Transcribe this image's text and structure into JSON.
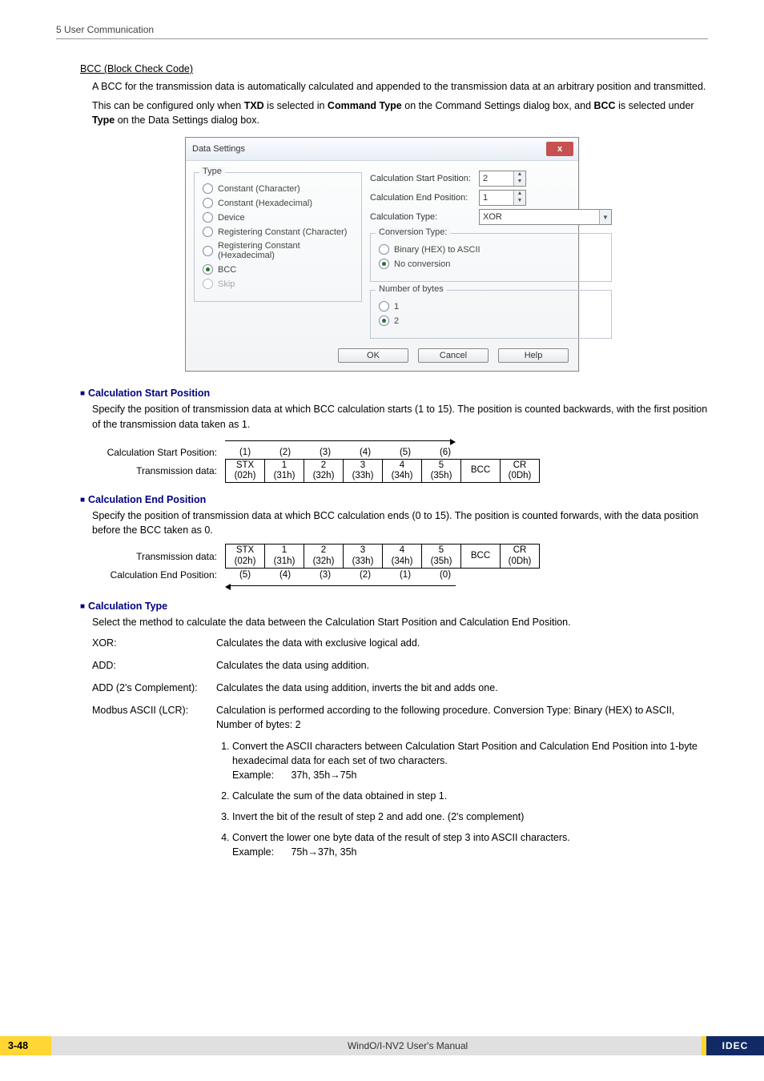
{
  "header": {
    "section": "5 User Communication"
  },
  "bcc": {
    "title": "BCC (Block Check Code)",
    "para1": "A BCC for the transmission data is automatically calculated and appended to the transmission data at an arbitrary position and transmitted.",
    "para2a": "This can be configured only when ",
    "para2_txd": "TXD",
    "para2b": " is selected in ",
    "para2_ct": "Command Type",
    "para2c": " on the Command Settings dialog box, and ",
    "para2_bcc": "BCC",
    "para2d": " is selected under ",
    "para2_type": "Type",
    "para2e": " on the Data Settings dialog box."
  },
  "dlg": {
    "title": "Data Settings",
    "close": "x",
    "type_legend": "Type",
    "t_constchar": "Constant (Character)",
    "t_consthex": "Constant (Hexadecimal)",
    "t_device": "Device",
    "t_regchar": "Registering Constant (Character)",
    "t_reghex": "Registering Constant (Hexadecimal)",
    "t_bcc": "BCC",
    "t_skip": "Skip",
    "calc_start_lbl": "Calculation Start Position:",
    "calc_start_val": "2",
    "calc_end_lbl": "Calculation End Position:",
    "calc_end_val": "1",
    "calc_type_lbl": "Calculation Type:",
    "calc_type_val": "XOR",
    "conv_legend": "Conversion Type:",
    "conv_bin": "Binary (HEX) to ASCII",
    "conv_none": "No conversion",
    "nbytes_legend": "Number of bytes",
    "nbytes_1": "1",
    "nbytes_2": "2",
    "btn_ok": "OK",
    "btn_cancel": "Cancel",
    "btn_help": "Help"
  },
  "calc_start": {
    "hdr": "Calculation Start Position",
    "para": "Specify the position of transmission data at which BCC calculation starts (1 to 15). The position is counted backwards, with the first position of the transmission data taken as 1.",
    "row_label": "Calculation Start Position:",
    "data_label": "Transmission data:",
    "seq": [
      "(1)",
      "(2)",
      "(3)",
      "(4)",
      "(5)",
      "(6)"
    ],
    "cells_top": [
      "STX",
      "1",
      "2",
      "3",
      "4",
      "5",
      "BCC",
      "CR"
    ],
    "cells_bot": [
      "(02h)",
      "(31h)",
      "(32h)",
      "(33h)",
      "(34h)",
      "(35h)",
      "",
      "(0Dh)"
    ]
  },
  "calc_end": {
    "hdr": "Calculation End Position",
    "para": "Specify the position of transmission data at which BCC calculation ends (0 to 15). The position is counted forwards, with the data position before the BCC taken as 0.",
    "row_label": "Calculation End Position:",
    "data_label": "Transmission data:",
    "seq": [
      "(5)",
      "(4)",
      "(3)",
      "(2)",
      "(1)",
      "(0)"
    ],
    "cells_top": [
      "STX",
      "1",
      "2",
      "3",
      "4",
      "5",
      "BCC",
      "CR"
    ],
    "cells_bot": [
      "(02h)",
      "(31h)",
      "(32h)",
      "(33h)",
      "(34h)",
      "(35h)",
      "",
      "(0Dh)"
    ]
  },
  "calc_type": {
    "hdr": "Calculation Type",
    "para": "Select the method to calculate the data between the Calculation Start Position and Calculation End Position.",
    "xor_k": "XOR:",
    "xor_v": "Calculates the data with exclusive logical add.",
    "add_k": "ADD:",
    "add_v": "Calculates the data using addition.",
    "add2c_k": "ADD (2's Complement):",
    "add2c_v": "Calculates the data using addition, inverts the bit and adds one.",
    "modbus_k": "Modbus ASCII (LCR):",
    "modbus_v": "Calculation is performed according to the following procedure. Conversion Type: Binary (HEX) to ASCII, Number of bytes: 2",
    "step1": "Convert the ASCII characters between Calculation Start Position and Calculation End Position into 1-byte hexadecimal data for each set of two characters.",
    "step1_example_lbl": "Example:",
    "step1_example_v": "37h, 35h→75h",
    "step2": "Calculate the sum of the data obtained in step 1.",
    "step3": "Invert the bit of the result of step 2 and add one. (2's complement)",
    "step4": "Convert the lower one byte data of the result of step 3 into ASCII characters.",
    "step4_example_lbl": "Example:",
    "step4_example_v": "75h→37h, 35h"
  },
  "footer": {
    "pageno": "3-48",
    "center": "WindO/I-NV2 User's Manual",
    "brand": "IDEC"
  }
}
